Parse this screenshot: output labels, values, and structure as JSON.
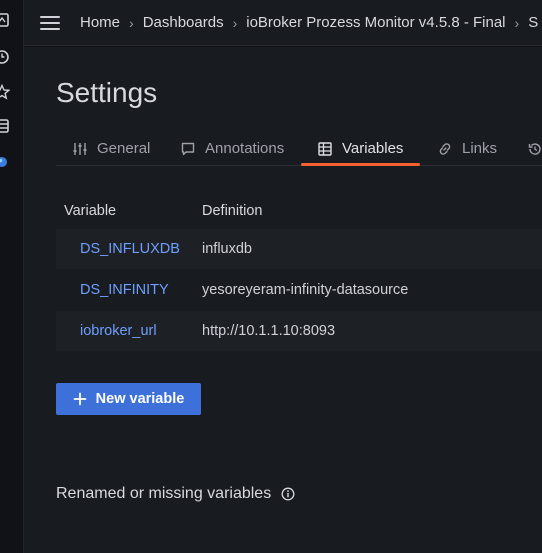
{
  "breadcrumb": {
    "items": [
      "Home",
      "Dashboards",
      "ioBroker Prozess Monitor v4.5.8 - Final",
      "S"
    ],
    "separator": "›"
  },
  "page": {
    "title": "Settings"
  },
  "tabs": [
    {
      "label": "General",
      "icon": "sliders-icon",
      "active": false
    },
    {
      "label": "Annotations",
      "icon": "comment-icon",
      "active": false
    },
    {
      "label": "Variables",
      "icon": "table-icon",
      "active": true
    },
    {
      "label": "Links",
      "icon": "link-icon",
      "active": false
    },
    {
      "label": "",
      "icon": "history-icon",
      "active": false
    }
  ],
  "variables_table": {
    "headers": {
      "variable": "Variable",
      "definition": "Definition"
    },
    "rows": [
      {
        "name": "DS_INFLUXDB",
        "definition": "influxdb"
      },
      {
        "name": "DS_INFINITY",
        "definition": "yesoreyeram-infinity-datasource"
      },
      {
        "name": "iobroker_url",
        "definition": "http://10.1.1.10:8093"
      }
    ]
  },
  "buttons": {
    "new_variable": "New variable"
  },
  "renamed_section": {
    "title": "Renamed or missing variables"
  },
  "colors": {
    "accent": "#f4602f",
    "link": "#6e9fff",
    "primary_button": "#3d71d9",
    "background": "#181b1f"
  }
}
